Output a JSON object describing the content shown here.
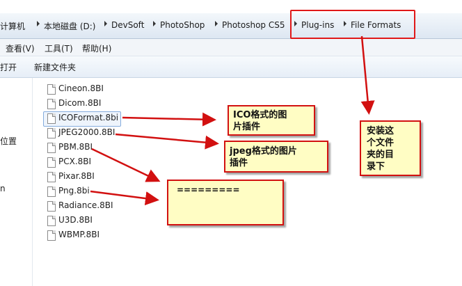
{
  "breadcrumb": [
    "计算机",
    "本地磁盘 (D:)",
    "DevSoft",
    "PhotoShop",
    "Photoshop CS5",
    "Plug-ins",
    "File Formats"
  ],
  "menu": [
    "查看(V)",
    "工具(T)",
    "帮助(H)"
  ],
  "toolbar": {
    "open": "打开",
    "new_folder": "新建文件夹"
  },
  "left_pane": [
    "位置",
    "n"
  ],
  "files": [
    "Cineon.8BI",
    "Dicom.8BI",
    "ICOFormat.8bi",
    "JPEG2000.8BI",
    "PBM.8BI",
    "PCX.8BI",
    "Pixar.8BI",
    "Png.8bi",
    "Radiance.8BI",
    "U3D.8BI",
    "WBMP.8BI"
  ],
  "selected_file": "ICOFormat.8bi",
  "notes": {
    "ico": [
      "ICO格式的图",
      "片插件"
    ],
    "jpeg": [
      "jpeg格式的图片",
      "插件"
    ],
    "png": "=========",
    "dir": [
      "安装这",
      "个文件",
      "夹的目",
      "录下"
    ]
  },
  "colors": {
    "annotation_red": "#d21010",
    "note_bg": "#fffdc4",
    "selection": "#eef4fc"
  }
}
